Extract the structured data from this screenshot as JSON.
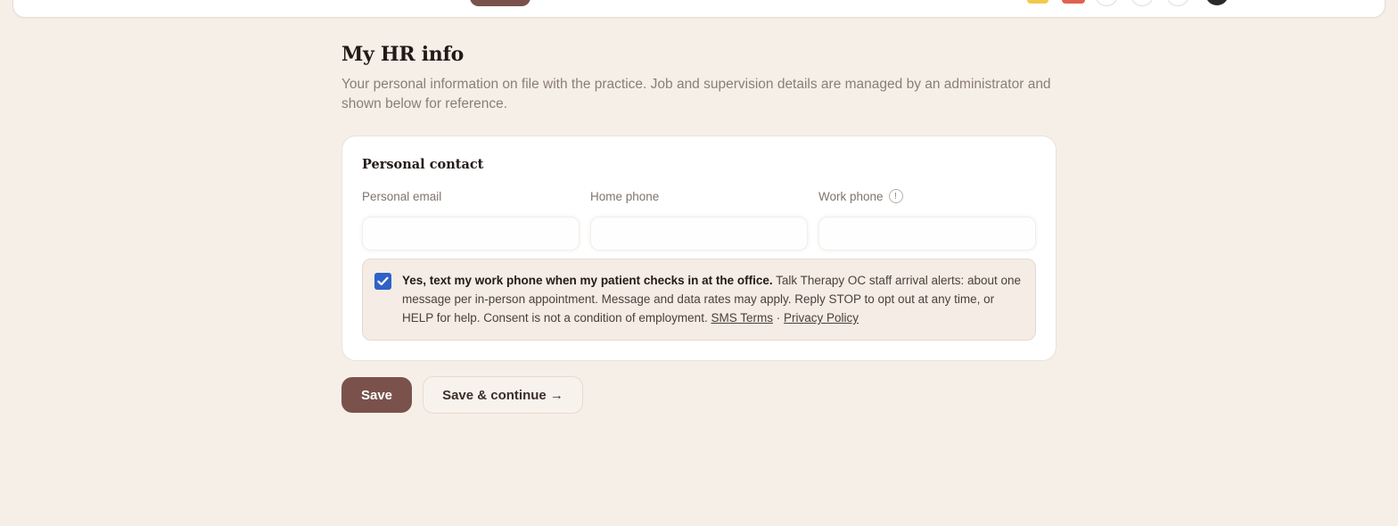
{
  "page": {
    "title": "My HR info",
    "subtitle": "Your personal information on file with the practice. Job and supervision details are managed by an administrator and shown below for reference."
  },
  "personal_contact": {
    "title": "Personal contact",
    "fields": [
      {
        "label": "Personal email",
        "value": ""
      },
      {
        "label": "Home phone",
        "value": ""
      },
      {
        "label": "Work phone",
        "value": "",
        "info_icon": "info-icon"
      }
    ]
  },
  "consent": {
    "checked": true,
    "bold_text": "Yes, text my work phone when my patient checks in at the office.",
    "body_text": "Talk Therapy OC staff arrival alerts: about one message per in-person appointment. Message and data rates may apply. Reply STOP to opt out at any time, or HELP for help. Consent is not a condition of employment.",
    "sms_terms_link": "SMS Terms",
    "separator": "·",
    "privacy_link": "Privacy Policy"
  },
  "actions": {
    "save_label": "Save",
    "save_continue_label": "Save & continue →"
  },
  "colors": {
    "background": "#f6efe8",
    "accent": "#7a524b",
    "checkbox": "#2f62c7"
  }
}
